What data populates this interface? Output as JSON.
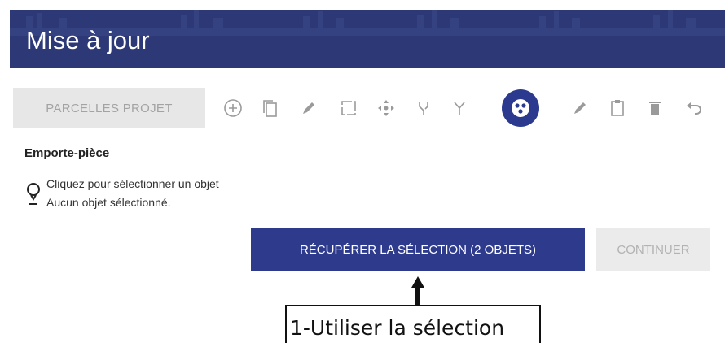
{
  "header": {
    "title": "Mise à jour"
  },
  "toolbar": {
    "layer_label": "PARCELLES PROJET",
    "tools": [
      {
        "icon": "add-circle-icon"
      },
      {
        "icon": "copy-icon"
      },
      {
        "icon": "pencil-icon"
      },
      {
        "icon": "crop-icon"
      },
      {
        "icon": "move-icon"
      },
      {
        "icon": "merge-icon"
      },
      {
        "icon": "split-icon"
      },
      {
        "icon": "cookie-cutter-icon",
        "active": true
      },
      {
        "icon": "edit-pencil-icon"
      },
      {
        "icon": "clipboard-icon"
      },
      {
        "icon": "trash-icon"
      },
      {
        "icon": "undo-icon"
      }
    ]
  },
  "panel": {
    "tool_title": "Emporte-pièce",
    "hint_line1": "Cliquez pour sélectionner un objet",
    "hint_line2": "Aucun objet sélectionné.",
    "hint_icon": "lightbulb-icon"
  },
  "actions": {
    "recover_label": "RÉCUPÉRER LA SÉLECTION (2 OBJETS)",
    "continue_label": "CONTINUER"
  },
  "annotation": {
    "text": "1-Utiliser la sélection"
  },
  "colors": {
    "header": "#2c3976",
    "accent": "#2b3a8e",
    "disabled": "#e7e7e7"
  }
}
